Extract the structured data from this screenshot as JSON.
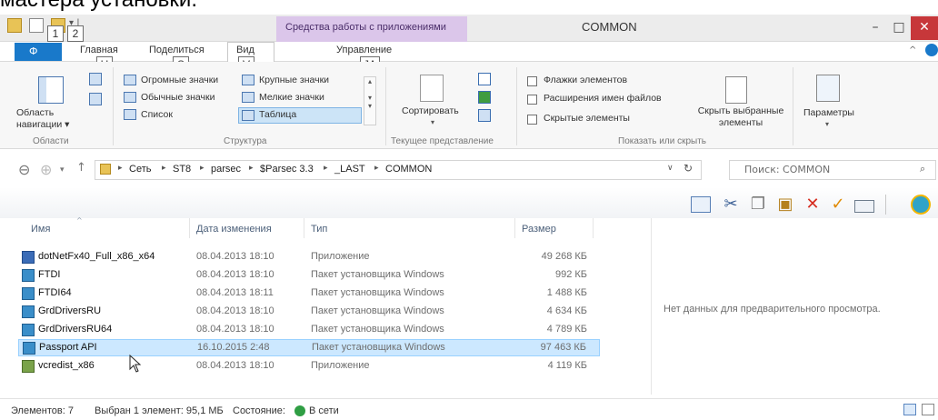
{
  "caption": "мастера установки.",
  "window": {
    "title": "COMMON",
    "context_tab": "Средства работы с приложениями",
    "minimize": "–",
    "maximize": "□",
    "close": "✕"
  },
  "keytips": {
    "qat1": "1",
    "qat2": "2",
    "home": "H",
    "share": "S",
    "view": "V",
    "manage": "JA"
  },
  "tabs": {
    "file": "Ф",
    "home": "Главная",
    "share": "Поделиться",
    "view": "Вид",
    "manage": "Управление"
  },
  "ribbon": {
    "nav_pane": "Область\nнавигации ▾",
    "layout": {
      "huge": "Огромные значки",
      "large": "Крупные значки",
      "normal": "Обычные значки",
      "small": "Мелкие значки",
      "list": "Список",
      "table": "Таблица"
    },
    "sort": "Сортировать",
    "show_hide": {
      "item_flags": "Флажки элементов",
      "extensions": "Расширения имен файлов",
      "hidden": "Скрытые элементы",
      "hide_selected": "Скрыть выбранные элементы"
    },
    "options": "Параметры",
    "groups": {
      "areas": "Области",
      "structure": "Структура",
      "current_view": "Текущее представление",
      "show_hide": "Показать или скрыть"
    }
  },
  "address": {
    "crumbs": [
      "Сеть",
      "ST8",
      "parsec",
      "$Parsec 3.3",
      "_LAST",
      "COMMON"
    ],
    "search_placeholder": "Поиск: COMMON"
  },
  "columns": {
    "name": "Имя",
    "date": "Дата изменения",
    "type": "Тип",
    "size": "Размер"
  },
  "files": [
    {
      "name": "dotNetFx40_Full_x86_x64",
      "date": "08.04.2013 18:10",
      "type": "Приложение",
      "size": "49 268 КБ"
    },
    {
      "name": "FTDI",
      "date": "08.04.2013 18:10",
      "type": "Пакет установщика Windows",
      "size": "992 КБ"
    },
    {
      "name": "FTDI64",
      "date": "08.04.2013 18:11",
      "type": "Пакет установщика Windows",
      "size": "1 488 КБ"
    },
    {
      "name": "GrdDriversRU",
      "date": "08.04.2013 18:10",
      "type": "Пакет установщика Windows",
      "size": "4 634 КБ"
    },
    {
      "name": "GrdDriversRU64",
      "date": "08.04.2013 18:10",
      "type": "Пакет установщика Windows",
      "size": "4 789 КБ"
    },
    {
      "name": "Passport API",
      "date": "16.10.2015 2:48",
      "type": "Пакет установщика Windows",
      "size": "97 463 КБ"
    },
    {
      "name": "vcredist_x86",
      "date": "08.04.2013 18:10",
      "type": "Приложение",
      "size": "4 119 КБ"
    }
  ],
  "preview": "Нет данных для предварительного просмотра.",
  "status": {
    "count": "Элементов: 7",
    "selected": "Выбран 1 элемент: 95,1 МБ",
    "state_label": "Состояние:",
    "state_value": "В сети"
  }
}
